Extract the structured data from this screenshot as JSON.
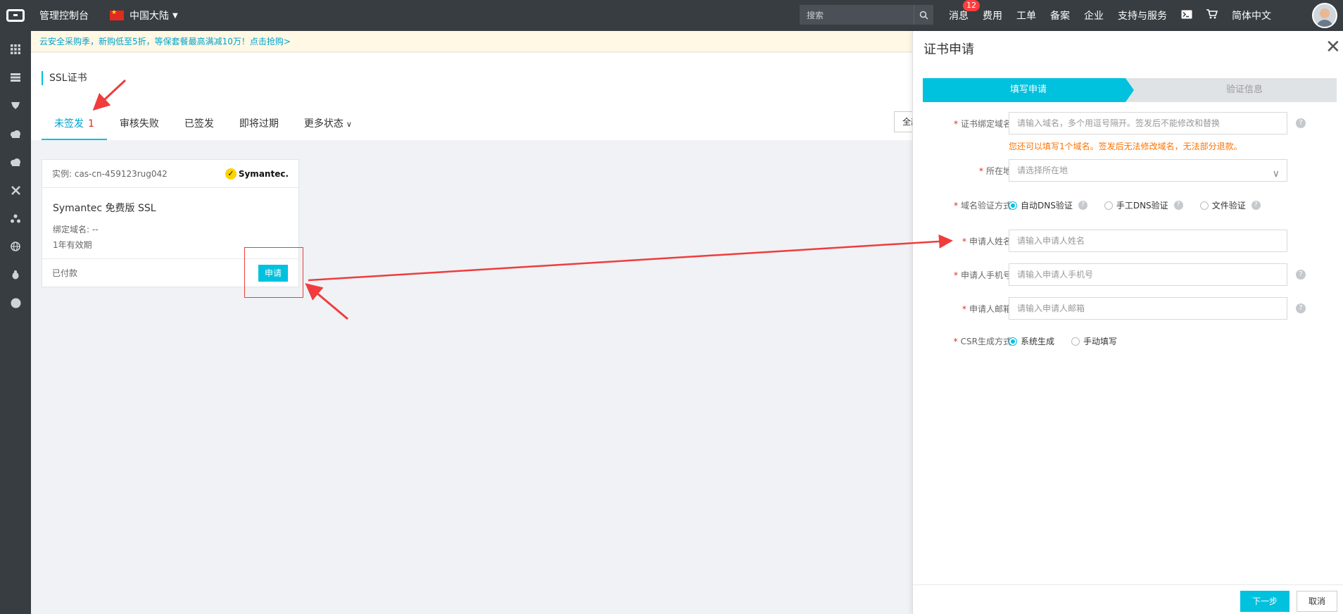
{
  "topbar": {
    "console": "管理控制台",
    "region": "中国大陆",
    "search_placeholder": "搜索",
    "nav": {
      "messages": "消息",
      "messages_count": "12",
      "fees": "费用",
      "tickets": "工单",
      "icp": "备案",
      "enterprise": "企业",
      "support": "支持与服务",
      "language": "简体中文"
    }
  },
  "notice": "云安全采购季，新购低至5折，等保套餐最高满减10万！点击抢购>",
  "page": {
    "title": "SSL证书",
    "tabs": [
      {
        "label": "未签发",
        "count": "1"
      },
      {
        "label": "审核失败"
      },
      {
        "label": "已签发"
      },
      {
        "label": "即将过期"
      },
      {
        "label": "更多状态"
      }
    ],
    "brand_filter": "全部品牌"
  },
  "card": {
    "instance": "实例: cas-cn-459123rug042",
    "brand": "Symantec.",
    "name": "Symantec 免费版 SSL",
    "domain": "绑定域名: --",
    "validity": "1年有效期",
    "status": "已付款",
    "apply": "申请"
  },
  "drawer": {
    "title": "证书申请",
    "steps": [
      "填写申请",
      "验证信息"
    ],
    "fields": {
      "domain_label": "证书绑定域名:",
      "domain_placeholder": "请输入域名，多个用逗号隔开。签发后不能修改和替换",
      "domain_hint": "您还可以填写1个域名。签发后无法修改域名，无法部分退款。",
      "location_label": "所在地:",
      "location_placeholder": "请选择所在地",
      "verify_label": "域名验证方式:",
      "verify_options": [
        "自动DNS验证",
        "手工DNS验证",
        "文件验证"
      ],
      "name_label": "申请人姓名:",
      "name_placeholder": "请输入申请人姓名",
      "phone_label": "申请人手机号:",
      "phone_placeholder": "请输入申请人手机号",
      "email_label": "申请人邮箱:",
      "email_placeholder": "请输入申请人邮箱",
      "csr_label": "CSR生成方式:",
      "csr_options": [
        "系统生成",
        "手动填写"
      ]
    },
    "next": "下一步",
    "cancel": "取消"
  },
  "colors": {
    "accent": "#00c1de",
    "topbar": "#373d41",
    "required": "#e02b20",
    "hint": "#ff7200",
    "annotation": "#f03c3c"
  }
}
